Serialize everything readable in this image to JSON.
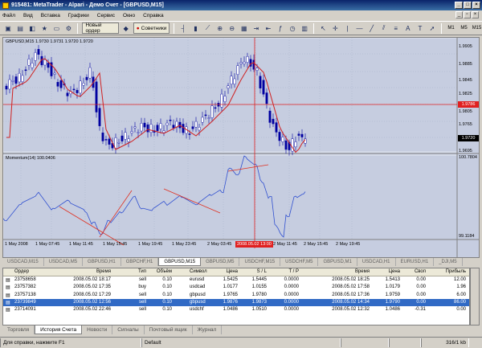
{
  "window": {
    "title": "915481: MetaTrader - Alpari - Демо Счет - [GBPUSD,M15]"
  },
  "menu": [
    "Файл",
    "Вид",
    "Вставка",
    "Графики",
    "Сервис",
    "Окно",
    "Справка"
  ],
  "toolbar": {
    "new_order": "Новый ордер",
    "experts": "Советники",
    "timeframes": [
      "M1",
      "M5",
      "M15"
    ]
  },
  "chart": {
    "header": "GBPUSD,M15  1.9730 1.9731 1.9720 1.9720",
    "price_ticks": [
      "1.9905",
      "1.9885",
      "1.9845",
      "1.9825",
      "1.9805",
      "1.9765",
      "1.9745",
      "1.9695"
    ],
    "hline_price": "1.9786",
    "last_price": "1.9720",
    "indicator_label": "Momentum(14) 100.0406",
    "ind_ticks": [
      "100.7804",
      "99.1184"
    ],
    "time_labels": [
      "1 May 2008",
      "1 May 07:45",
      "1 May 11:45",
      "1 May 15:45",
      "1 May 19:45",
      "1 May 23:45",
      "2 May 03:45",
      "2 May 07:45",
      "2 May 11:45",
      "2 May 15:45",
      "2 May 19:45"
    ],
    "vline_time": "2008.05.02 13:00"
  },
  "tabs": [
    "USDCAD,M15",
    "USDCAD,M5",
    "GBPUSD,H1",
    "GBPCHF,H1",
    "GBPUSD,M15",
    "GBPUSD,M5",
    "USDCHF,M15",
    "USDCHF,M5",
    "GBPUSD,M1",
    "USDCAD,H1",
    "EURUSD,H1",
    "_DJI,M5"
  ],
  "active_tab": 4,
  "terminal": {
    "headers": [
      "Ордер",
      "Время",
      "Тип",
      "Объём",
      "Символ",
      "Цена",
      "S / L",
      "T / P",
      "Время",
      "Цена",
      "Своп",
      "Прибыль"
    ],
    "rows": [
      [
        "23758658",
        "2008.05.02 18:17",
        "sell",
        "0.10",
        "eurusd",
        "1.5425",
        "1.5445",
        "0.0000",
        "2008.05.02 18:25",
        "1.5413",
        "0.00",
        "12.00"
      ],
      [
        "23757382",
        "2008.05.02 17:35",
        "buy",
        "0.10",
        "usdcad",
        "1.0177",
        "1.0155",
        "0.0000",
        "2008.05.02 17:58",
        "1.0179",
        "0.00",
        "1.96"
      ],
      [
        "23757138",
        "2008.05.02 17:29",
        "sell",
        "0.10",
        "gbpusd",
        "1.9765",
        "1.9780",
        "0.0000",
        "2008.05.02 17:36",
        "1.9759",
        "0.00",
        "6.00"
      ],
      [
        "23739849",
        "2008.05.02 12:56",
        "sell",
        "0.10",
        "gbpusd",
        "1.9876",
        "1.9873",
        "0.0000",
        "2008.05.02 14:34",
        "1.9790",
        "0.00",
        "86.00"
      ],
      [
        "23714091",
        "2008.05.02 22:46",
        "sell",
        "0.10",
        "usdchf",
        "1.0486",
        "1.0510",
        "0.0000",
        "2008.05.02 12:32",
        "1.0486",
        "-0.31",
        "0.00"
      ]
    ],
    "selected_row": 3
  },
  "bottom_tabs": [
    "Торговля",
    "История Счета",
    "Новости",
    "Сигналы",
    "Почтовый ящик",
    "Журнал"
  ],
  "active_bottom_tab": 1,
  "status": {
    "help": "Для справки, нажмите F1",
    "profile": "Default",
    "traffic": "316/1 kb"
  },
  "colors": {
    "chart_bg": "#c6cde0",
    "candle": "#0000c0",
    "ma": "#d02020",
    "momentum": "#3050d0",
    "trend": "#e03020"
  }
}
